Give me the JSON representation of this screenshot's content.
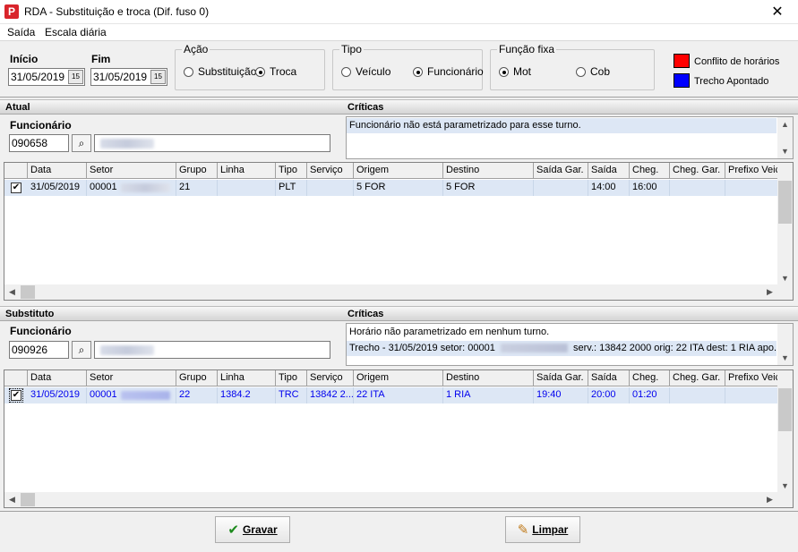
{
  "window": {
    "title": "RDA - Substituição e troca (Dif. fuso 0)",
    "close_glyph": "✕"
  },
  "menu": [
    "Saída",
    "Escala diária"
  ],
  "filters": {
    "inicio_label": "Início",
    "inicio_value": "31/05/2019",
    "fim_label": "Fim",
    "fim_value": "31/05/2019",
    "acao": {
      "title": "Ação",
      "options": [
        "Substituição",
        "Troca"
      ],
      "selected": "Troca"
    },
    "tipo": {
      "title": "Tipo",
      "options": [
        "Veículo",
        "Funcionário"
      ],
      "selected": "Funcionário"
    },
    "funcao": {
      "title": "Função fixa",
      "options": [
        "Mot",
        "Cob"
      ],
      "selected": "Mot"
    }
  },
  "legend": [
    {
      "label": "Conflito de horários",
      "color": "#ff0000"
    },
    {
      "label": "Trecho Apontado",
      "color": "#0000ff"
    }
  ],
  "atual": {
    "section_label": "Atual",
    "criticas_label": "Críticas",
    "funcionario_label": "Funcionário",
    "funcionario_code": "090658",
    "criticas": [
      "Funcionário não está parametrizado para esse turno."
    ]
  },
  "substituto": {
    "section_label": "Substituto",
    "criticas_label": "Críticas",
    "funcionario_label": "Funcionário",
    "funcionario_code": "090926",
    "criticas": [
      "Horário não parametrizado em nenhum turno.",
      "Trecho - 31/05/2019 setor:  00001",
      "serv.: 13842 2000 orig: 22 ITA dest: 1 RIA apo..."
    ]
  },
  "grid_headers": [
    "Data",
    "Setor",
    "Grupo",
    "Linha",
    "Tipo",
    "Serviço",
    "Origem",
    "Destino",
    "Saída Gar.",
    "Saída",
    "Cheg.",
    "Cheg. Gar.",
    "Prefixo Veic"
  ],
  "atual_rows": [
    {
      "checked": true,
      "cells": [
        "31/05/2019",
        "00001",
        "21",
        "",
        "PLT",
        "",
        "5 FOR",
        "5 FOR",
        "",
        "14:00",
        "16:00",
        "",
        ""
      ]
    }
  ],
  "substituto_rows": [
    {
      "checked": true,
      "cells": [
        "31/05/2019",
        "00001",
        "22",
        "1384.2",
        "TRC",
        "13842 2...",
        "22 ITA",
        "1 RIA",
        "19:40",
        "20:00",
        "01:20",
        "",
        ""
      ]
    }
  ],
  "buttons": {
    "gravar": "Gravar",
    "limpar": "Limpar"
  }
}
